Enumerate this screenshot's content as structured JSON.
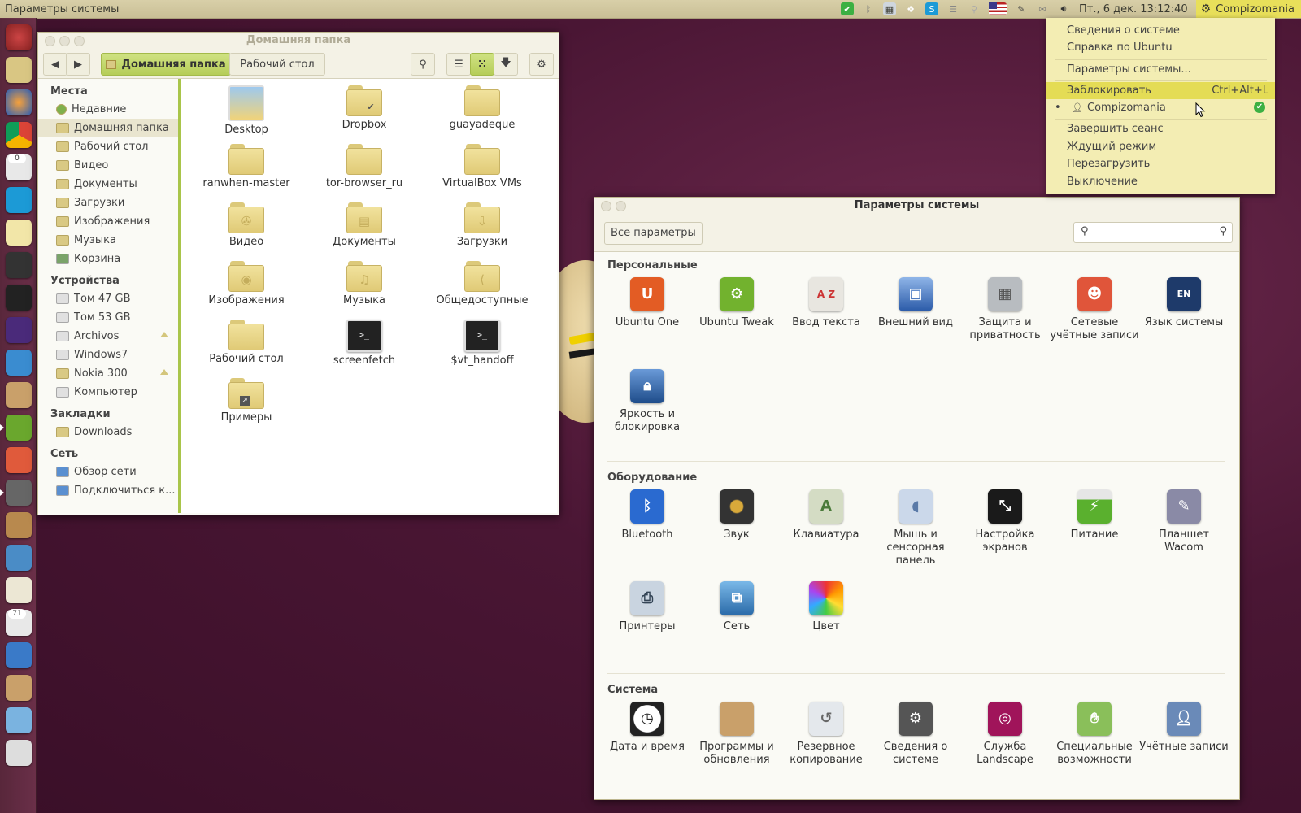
{
  "top_panel": {
    "app_title": "Параметры системы",
    "clock": "Пт., 6 дек. 13:12:40",
    "user": "Compizomania"
  },
  "launcher": {
    "badges": [
      "0",
      "71"
    ]
  },
  "file_manager": {
    "title": "Домашняя папка",
    "breadcrumbs": [
      "Домашняя папка",
      "Рабочий стол"
    ],
    "sidebar": {
      "places_header": "Места",
      "places": [
        "Недавние",
        "Домашняя папка",
        "Рабочий стол",
        "Видео",
        "Документы",
        "Загрузки",
        "Изображения",
        "Музыка",
        "Корзина"
      ],
      "devices_header": "Устройства",
      "devices": [
        "Том 47 GB",
        "Том 53 GB",
        "Archivos",
        "Windows7",
        "Nokia 300",
        "Компьютер"
      ],
      "bookmarks_header": "Закладки",
      "bookmarks": [
        "Downloads"
      ],
      "network_header": "Сеть",
      "network": [
        "Обзор сети",
        "Подключиться к..."
      ]
    },
    "files": [
      "Desktop",
      "Dropbox",
      "guayadeque",
      "ranwhen-master",
      "tor-browser_ru",
      "VirtualBox VMs",
      "Видео",
      "Документы",
      "Загрузки",
      "Изображения",
      "Музыка",
      "Общедоступные",
      "Рабочий стол",
      "screenfetch",
      "$vt_handoff",
      "Примеры"
    ]
  },
  "settings": {
    "title": "Параметры системы",
    "all_button": "Все параметры",
    "sections": {
      "personal": {
        "label": "Персональные",
        "items": [
          "Ubuntu One",
          "Ubuntu Tweak",
          "Ввод текста",
          "Внешний вид",
          "Защита и приватность",
          "Сетевые учётные записи",
          "Язык системы",
          "Яркость и блокировка"
        ]
      },
      "hardware": {
        "label": "Оборудование",
        "items": [
          "Bluetooth",
          "Звук",
          "Клавиатура",
          "Мышь и сенсорная панель",
          "Настройка экранов",
          "Питание",
          "Планшет Wacom",
          "Принтеры",
          "Сеть",
          "Цвет"
        ]
      },
      "system": {
        "label": "Система",
        "items": [
          "Дата и время",
          "Программы и обновления",
          "Резервное копирование",
          "Сведения о системе",
          "Служба Landscape",
          "Специальные возможности",
          "Учётные записи"
        ]
      }
    }
  },
  "menu": {
    "items": [
      "Сведения о системе",
      "Справка по Ubuntu",
      "Параметры системы...",
      "Заблокировать",
      "Compizomania",
      "Завершить сеанс",
      "Ждущий режим",
      "Перезагрузить",
      "Выключение"
    ],
    "lock_shortcut": "Ctrl+Alt+L"
  },
  "colors": {
    "accent": "#a9c54a",
    "menu_highlight": "#e4dc55",
    "panel": "#d8cfa8"
  }
}
